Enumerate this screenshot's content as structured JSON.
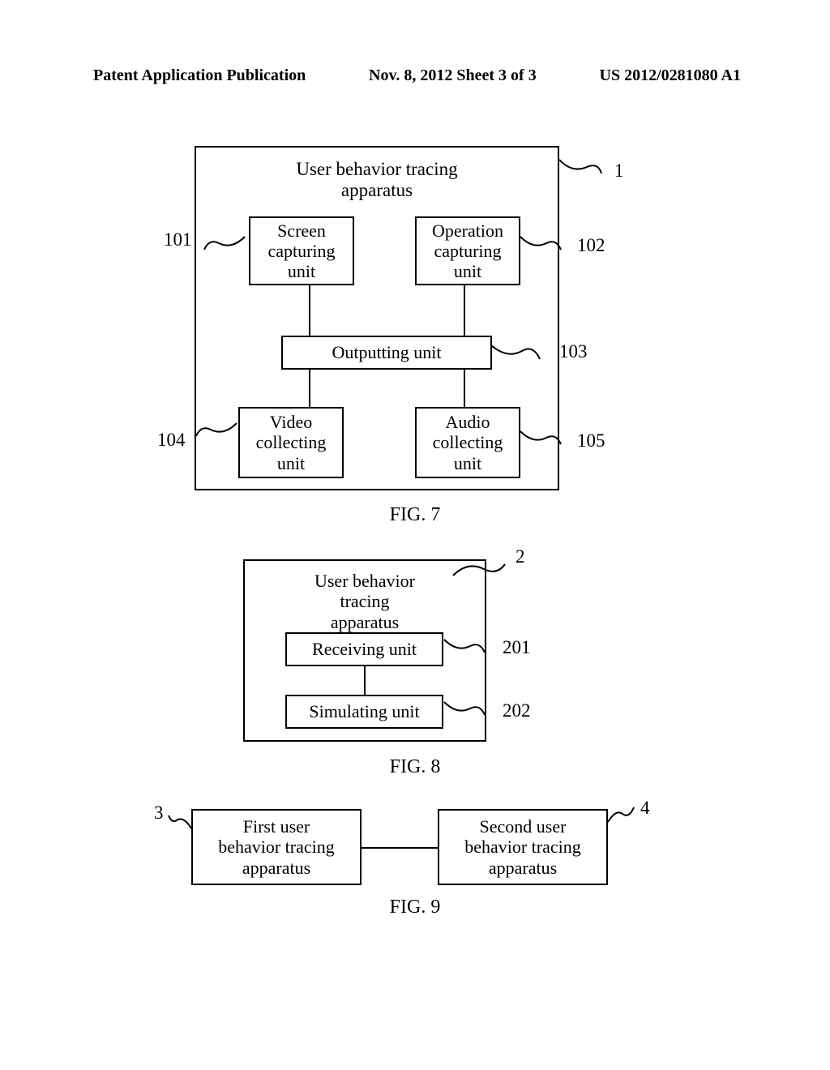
{
  "header": {
    "left": "Patent Application Publication",
    "center": "Nov. 8, 2012  Sheet 3 of 3",
    "right": "US 2012/0281080 A1"
  },
  "fig7": {
    "title": "User behavior tracing\napparatus",
    "block101": "Screen\ncapturing\nunit",
    "block102": "Operation\ncapturing\nunit",
    "block103": "Outputting unit",
    "block104": "Video\ncollecting\nunit",
    "block105": "Audio\ncollecting\nunit",
    "ref1": "1",
    "ref101": "101",
    "ref102": "102",
    "ref103": "103",
    "ref104": "104",
    "ref105": "105",
    "caption": "FIG. 7"
  },
  "fig8": {
    "title": "User behavior tracing\napparatus",
    "block201": "Receiving unit",
    "block202": "Simulating unit",
    "ref2": "2",
    "ref201": "201",
    "ref202": "202",
    "caption": "FIG. 8"
  },
  "fig9": {
    "block3": "First user\nbehavior tracing\napparatus",
    "block4": "Second user\nbehavior tracing\napparatus",
    "ref3": "3",
    "ref4": "4",
    "caption": "FIG. 9"
  }
}
